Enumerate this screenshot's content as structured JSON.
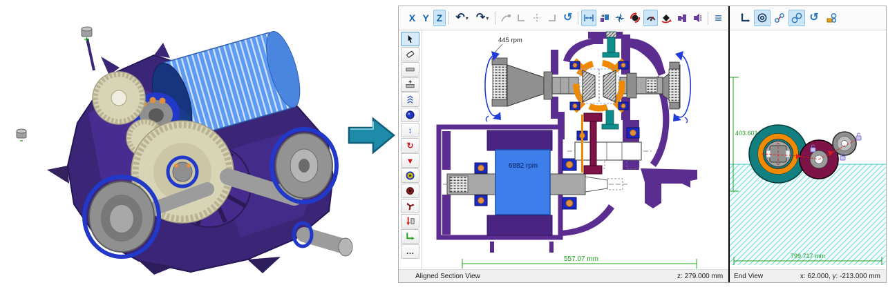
{
  "icons": {
    "undo": "↶",
    "redo": "↷",
    "dropdown": "▾",
    "rotate_cw": "↻",
    "rotate_ccw": "↺",
    "menu": "≡",
    "concentric": "◎",
    "move_vertical": "↕",
    "rotate_red": "↻",
    "marker_down": "▾"
  },
  "main_toolbar": {
    "axis": [
      "X",
      "Y",
      "Z"
    ]
  },
  "left_tools": {
    "more_label": "…"
  },
  "section_view": {
    "rpm_output": "445 rpm",
    "rpm_motor": "6882 rpm",
    "dim_width": "557.07 mm",
    "status_left": "Aligned Section View",
    "status_right": "z: 279.000 mm"
  },
  "end_view": {
    "dim_height": "403.601 mm",
    "dim_width": "799.717 mm",
    "status_left": "End View",
    "status_right": "x: 62.000, y: -213.000 mm"
  },
  "colors": {
    "housing_purple": "#5C2D91",
    "stator_purple": "#4B2382",
    "carrier_orange": "#F08A00",
    "rotor_blue": "#3D7EEB",
    "gear_maroon": "#7E1347",
    "gear_teal": "#128080",
    "dimension_green": "#1FA01F",
    "flow_arrow_teal": "#1E8CA8",
    "render_housing": "#3B2576",
    "render_gear_tan": "#D8D4B6",
    "toolbar_blue": "#1464B4",
    "bearing_blue": "#1828C8"
  }
}
